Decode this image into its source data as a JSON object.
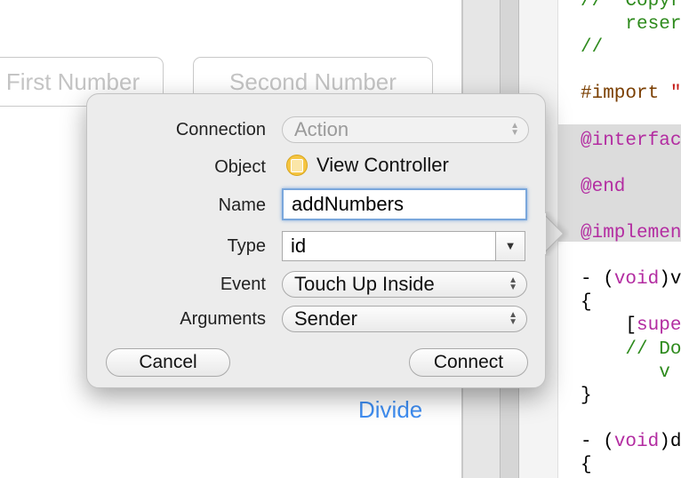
{
  "canvas": {
    "first_number_placeholder": "First Number",
    "second_number_placeholder": "Second Number",
    "divide_label": "Divide"
  },
  "code_lines": [
    {
      "text": "//  Copyr",
      "cls": "cm"
    },
    {
      "text": "    reser",
      "cls": "cm"
    },
    {
      "text": "//",
      "cls": "cm"
    },
    {
      "text": "",
      "cls": ""
    },
    {
      "text": "#import \"",
      "cls": "mac"
    },
    {
      "text": "",
      "cls": ""
    },
    {
      "text": "@interfac",
      "cls": "kw"
    },
    {
      "text": "",
      "cls": ""
    },
    {
      "text": "@end",
      "cls": "kw"
    },
    {
      "text": "",
      "cls": ""
    },
    {
      "text": "@implemen",
      "cls": "kw"
    },
    {
      "text": "",
      "cls": ""
    },
    {
      "text": "- (void)v",
      "cls": "mix"
    },
    {
      "text": "{",
      "cls": ""
    },
    {
      "text": "    [supe",
      "cls": "mix2"
    },
    {
      "text": "    // Do",
      "cls": "cm"
    },
    {
      "text": "       v",
      "cls": "cm"
    },
    {
      "text": "}",
      "cls": ""
    },
    {
      "text": "",
      "cls": ""
    },
    {
      "text": "- (void)d",
      "cls": "mix"
    },
    {
      "text": "{",
      "cls": ""
    }
  ],
  "popover": {
    "connection_label": "Connection",
    "connection_value": "Action",
    "object_label": "Object",
    "object_value": "View Controller",
    "name_label": "Name",
    "name_value": "addNumbers",
    "type_label": "Type",
    "type_value": "id",
    "event_label": "Event",
    "event_value": "Touch Up Inside",
    "arguments_label": "Arguments",
    "arguments_value": "Sender",
    "cancel_label": "Cancel",
    "connect_label": "Connect"
  }
}
